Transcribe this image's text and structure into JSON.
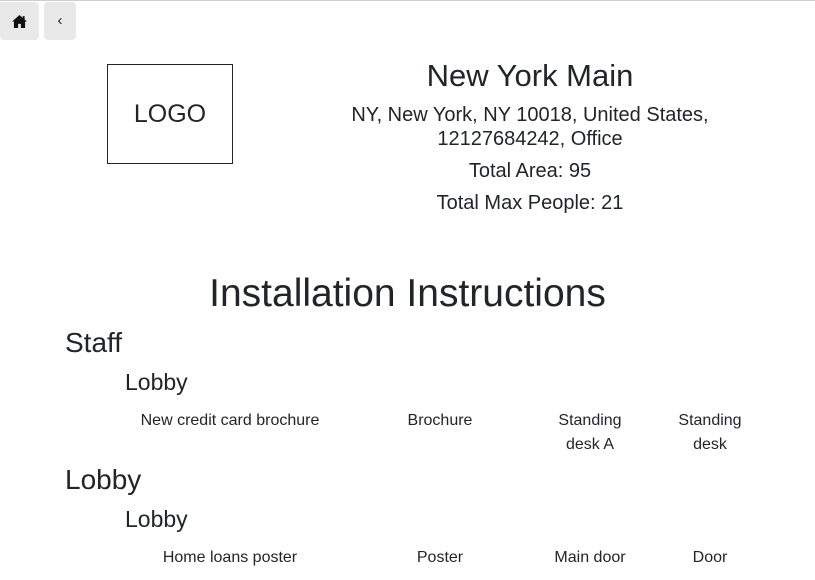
{
  "nav": {
    "home_icon": "home-icon",
    "back_label": "‹"
  },
  "header": {
    "logo_label": "LOGO",
    "title": "New York Main",
    "address_line1": "NY, New York, NY 10018, United States,",
    "address_line2": "12127684242, Office",
    "total_area": "Total Area: 95",
    "total_max_people": "Total Max People: 21"
  },
  "main": {
    "heading": "Installation Instructions",
    "sections": [
      {
        "title": "Staff",
        "subsections": [
          {
            "title": "Lobby",
            "rows": [
              {
                "item": "New credit card brochure",
                "type": "Brochure",
                "placement_line1": "Standing",
                "placement_line2": "desk A",
                "fixture_line1": "Standing",
                "fixture_line2": "desk"
              }
            ]
          }
        ]
      },
      {
        "title": "Lobby",
        "subsections": [
          {
            "title": "Lobby",
            "rows": [
              {
                "item": "Home loans poster",
                "type": "Poster",
                "placement": "Main door",
                "fixture": "Door"
              }
            ]
          }
        ]
      }
    ]
  }
}
